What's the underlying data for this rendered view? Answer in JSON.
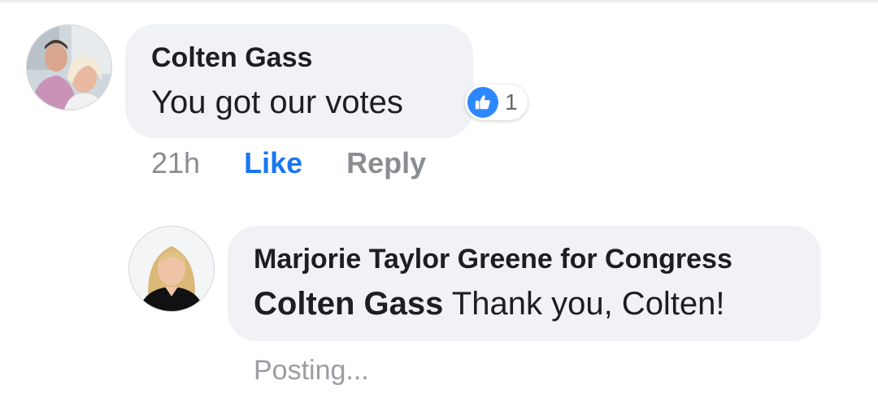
{
  "comment": {
    "author": "Colten Gass",
    "text": "You got our votes",
    "reaction_count": "1",
    "reaction_icon": "thumbs-up-icon",
    "timestamp": "21h",
    "like_label": "Like",
    "reply_label": "Reply"
  },
  "reply": {
    "author": "Marjorie Taylor Greene for Congress",
    "mention": "Colten Gass",
    "text": " Thank you, Colten!",
    "status": "Posting..."
  },
  "colors": {
    "bubble": "#f0f2f5",
    "like_blue": "#1877f2",
    "reaction_blue": "#2d88ff",
    "muted_text": "#8a8d91",
    "primary_text": "#1c1e21"
  }
}
